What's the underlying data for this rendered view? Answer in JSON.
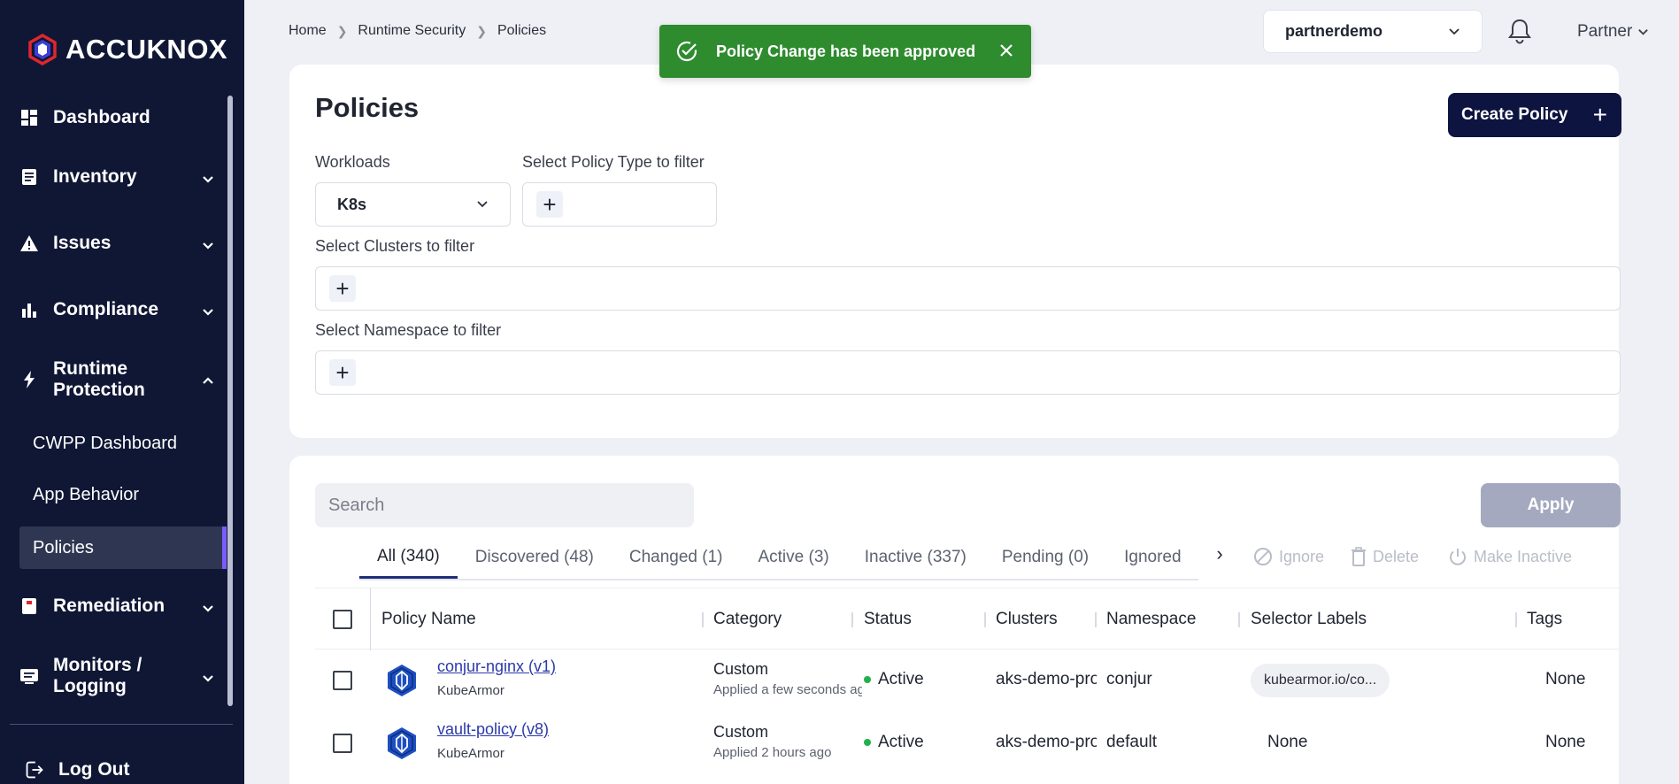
{
  "brand": {
    "name": "ACCUKNOX"
  },
  "sidebar": {
    "items": [
      {
        "label": "Dashboard"
      },
      {
        "label": "Inventory"
      },
      {
        "label": "Issues"
      },
      {
        "label": "Compliance"
      },
      {
        "label": "Runtime Protection",
        "expanded": true
      },
      {
        "label": "Remediation"
      },
      {
        "label": "Monitors / Logging"
      }
    ],
    "sub_items": [
      {
        "label": "CWPP Dashboard"
      },
      {
        "label": "App Behavior"
      },
      {
        "label": "Policies",
        "active": true
      }
    ],
    "logout": "Log Out"
  },
  "breadcrumb": [
    "Home",
    "Runtime Security",
    "Policies"
  ],
  "header": {
    "org": "partnerdemo",
    "user": "Partner"
  },
  "toast": {
    "message": "Policy Change has been approved",
    "color": "#2e8b2e"
  },
  "page": {
    "title": "Policies",
    "create_label": "Create Policy"
  },
  "filters": {
    "workloads_label": "Workloads",
    "workloads_value": "K8s",
    "policy_type_label": "Select Policy Type to filter",
    "clusters_label": "Select Clusters to filter",
    "namespace_label": "Select Namespace to filter"
  },
  "search": {
    "placeholder": "Search"
  },
  "apply_label": "Apply",
  "tabs": [
    {
      "label": "All (340)",
      "active": true
    },
    {
      "label": "Discovered (48)"
    },
    {
      "label": "Changed (1)"
    },
    {
      "label": "Active (3)"
    },
    {
      "label": "Inactive (337)"
    },
    {
      "label": "Pending (0)"
    },
    {
      "label": "Ignored"
    }
  ],
  "bulk_actions": {
    "ignore": "Ignore",
    "delete": "Delete",
    "make_inactive": "Make Inactive"
  },
  "table": {
    "columns": [
      "Policy Name",
      "Category",
      "Status",
      "Clusters",
      "Namespace",
      "Selector Labels",
      "Tags"
    ],
    "rows": [
      {
        "name": "conjur-nginx (v1)",
        "engine": "KubeArmor",
        "category": "Custom",
        "applied": "Applied a few seconds ago",
        "status": "Active",
        "cluster": "aks-demo-prod",
        "namespace": "conjur",
        "selector": "kubearmor.io/co...",
        "tags": "None"
      },
      {
        "name": "vault-policy (v8)",
        "engine": "KubeArmor",
        "category": "Custom",
        "applied": "Applied 2 hours ago",
        "status": "Active",
        "cluster": "aks-demo-prod",
        "namespace": "default",
        "selector": "None",
        "tags": "None"
      }
    ]
  },
  "colors": {
    "sidebar_bg": "#101735",
    "primary_button": "#0d1440",
    "active_status": "#22b04b",
    "link": "#2b3aa8"
  }
}
